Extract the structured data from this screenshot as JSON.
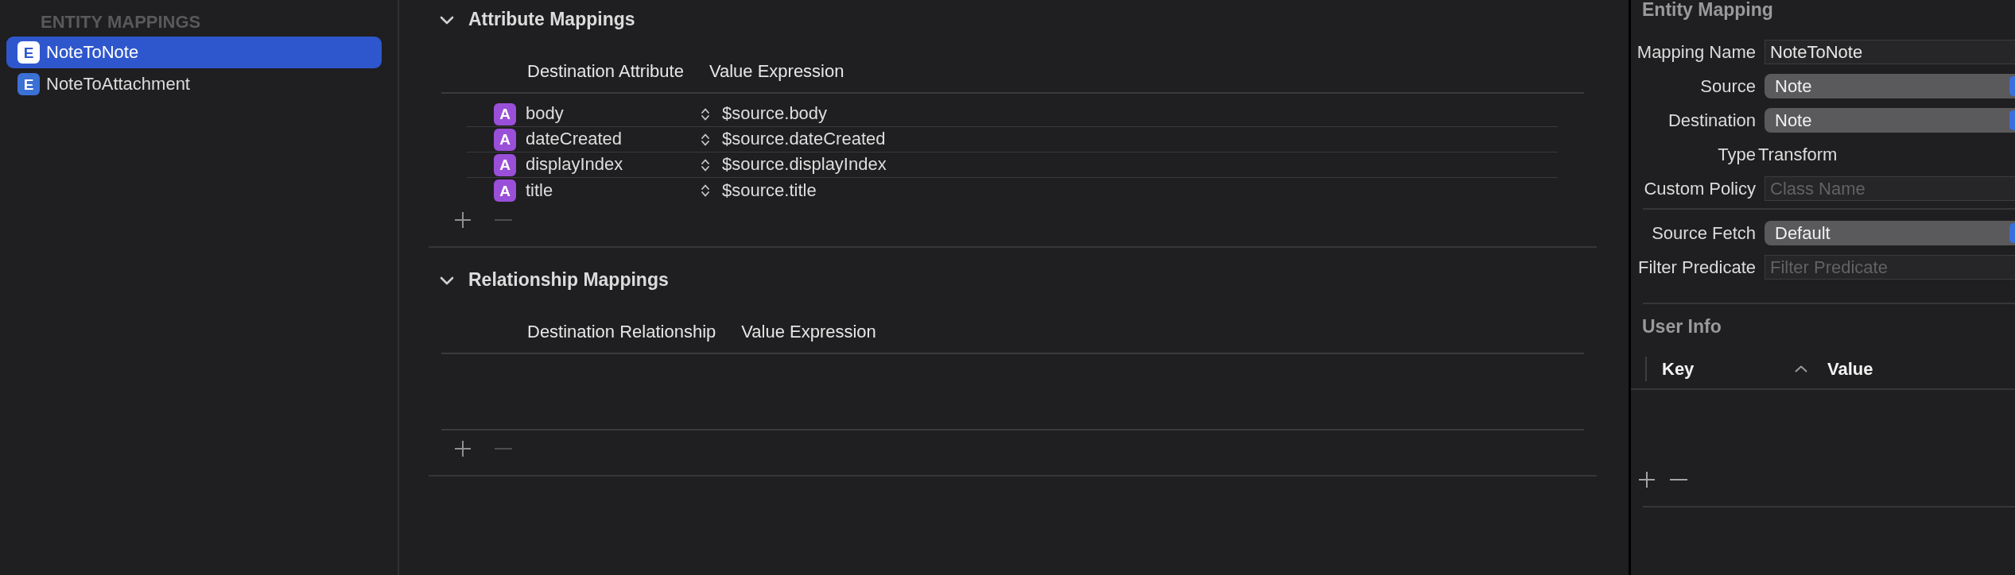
{
  "sidebar": {
    "header": "ENTITY MAPPINGS",
    "items": [
      {
        "icon": "E",
        "label": "NoteToNote",
        "selected": true
      },
      {
        "icon": "E",
        "label": "NoteToAttachment",
        "selected": false
      }
    ]
  },
  "sections": [
    {
      "title": "Attribute Mappings",
      "expanded": true,
      "columns": [
        "Destination Attribute",
        "Value Expression"
      ],
      "rows": [
        {
          "icon": "A",
          "name": "body",
          "value": "$source.body"
        },
        {
          "icon": "A",
          "name": "dateCreated",
          "value": "$source.dateCreated"
        },
        {
          "icon": "A",
          "name": "displayIndex",
          "value": "$source.displayIndex"
        },
        {
          "icon": "A",
          "name": "title",
          "value": "$source.title"
        }
      ],
      "buttons": [
        {
          "kind": "add",
          "disabled": false
        },
        {
          "kind": "remove",
          "disabled": true
        }
      ]
    },
    {
      "title": "Relationship Mappings",
      "expanded": true,
      "columns": [
        "Destination Relationship",
        "Value Expression"
      ],
      "buttons": [
        {
          "kind": "add",
          "disabled": false
        },
        {
          "kind": "remove",
          "disabled": true
        }
      ]
    }
  ],
  "inspector": {
    "title": "Entity Mapping",
    "groups": [
      {
        "fields": [
          {
            "label": "Mapping Name",
            "kind": "text",
            "value": "NoteToNote"
          },
          {
            "label": "Source",
            "kind": "popup",
            "value": "Note"
          },
          {
            "label": "Destination",
            "kind": "popup",
            "value": "Note"
          },
          {
            "label": "Type",
            "kind": "static",
            "value": "Transform"
          },
          {
            "label": "Custom Policy",
            "kind": "text",
            "placeholder": "Class Name"
          }
        ]
      },
      {
        "fields": [
          {
            "label": "Source Fetch",
            "kind": "popup",
            "value": "Default"
          },
          {
            "label": "Filter Predicate",
            "kind": "text",
            "placeholder": "Filter Predicate"
          }
        ]
      }
    ],
    "user_info": {
      "title": "User Info",
      "columns": [
        {
          "label": "Key",
          "sorted": true
        },
        {
          "label": "Value",
          "sorted": false
        }
      ],
      "buttons": [
        {
          "kind": "add",
          "disabled": false
        },
        {
          "kind": "remove",
          "disabled": false
        }
      ]
    }
  }
}
